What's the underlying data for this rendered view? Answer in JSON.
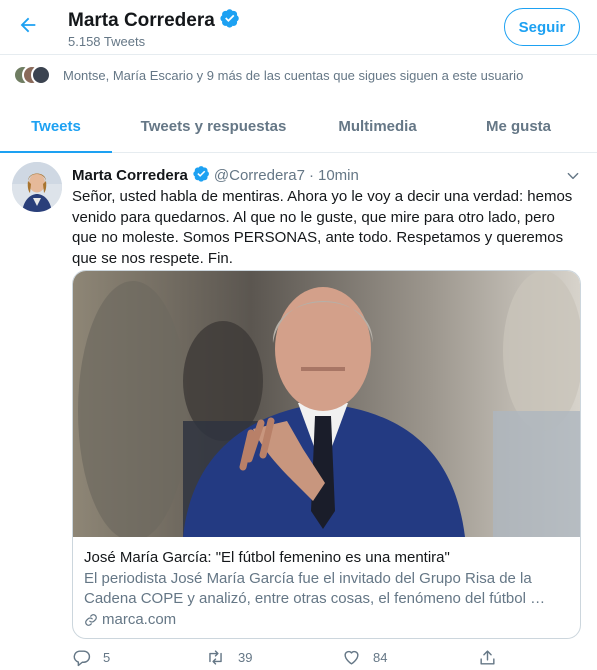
{
  "header": {
    "name": "Marta Corredera",
    "tweet_count": "5.158 Tweets",
    "follow_label": "Seguir"
  },
  "followers_note": "Montse, María Escario y 9 más de las cuentas que sigues siguen a este usuario",
  "tabs": [
    {
      "label": "Tweets",
      "active": true
    },
    {
      "label": "Tweets y respuestas",
      "active": false
    },
    {
      "label": "Multimedia",
      "active": false
    },
    {
      "label": "Me gusta",
      "active": false
    }
  ],
  "tweet": {
    "name": "Marta Corredera",
    "handle": "@Corredera7",
    "separator": "·",
    "time": "10min",
    "text": "Señor, usted habla de mentiras. Ahora yo le voy a decir una verdad: hemos venido para quedarnos. Al que no le guste, que mire para otro lado, pero que no moleste. Somos PERSONAS, ante todo. Respetamos y queremos que se nos respete. Fin.",
    "card": {
      "title": "José María García: \"El fútbol femenino es una mentira\"",
      "description": "El periodista José María García fue el invitado del Grupo Risa de la Cadena COPE y analizó, entre otras cosas, el fenómeno del fútbol …",
      "domain": "marca.com",
      "image": "press-photo-elderly-man-in-suit-waving"
    },
    "actions": {
      "replies": "5",
      "retweets": "39",
      "likes": "84"
    }
  },
  "icons": {
    "back": "arrow-left-icon",
    "verified": "verified-badge-icon",
    "caret": "chevron-down-icon",
    "link": "link-icon",
    "reply": "reply-icon",
    "retweet": "retweet-icon",
    "like": "heart-icon",
    "share": "share-icon"
  },
  "colors": {
    "accent": "#1da1f2",
    "secondary_text": "#657786",
    "primary_text": "#14171a",
    "border": "#e6ecf0"
  }
}
